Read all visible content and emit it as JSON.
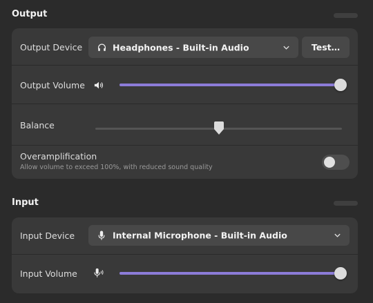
{
  "output": {
    "title": "Output",
    "device_label": "Output Device",
    "device_value": "Headphones - Built-in Audio",
    "test_button": "Test…",
    "volume_label": "Output Volume",
    "volume_level": 1.0,
    "balance_label": "Balance",
    "balance_level": 0.5,
    "overamp_label": "Overamplification",
    "overamp_sub": "Allow volume to exceed 100%, with reduced sound quality",
    "overamp_enabled": false
  },
  "input": {
    "title": "Input",
    "device_label": "Input Device",
    "device_value": "Internal Microphone - Built-in Audio",
    "volume_label": "Input Volume",
    "volume_level": 1.0
  },
  "icons": {
    "headphones": "headphones-icon",
    "speaker": "speaker-icon",
    "microphone": "microphone-icon",
    "microphone_sensitivity": "microphone-sensitivity-icon",
    "chevron": "chevron-down-icon"
  },
  "colors": {
    "accent": "#8c7cd8",
    "background": "#2b2b2b",
    "card": "#393939"
  }
}
